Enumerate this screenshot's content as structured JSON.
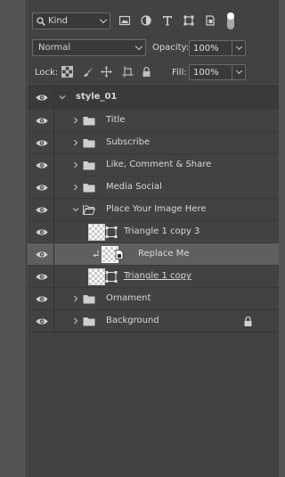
{
  "filter": {
    "kind_label": "Kind",
    "icons": [
      "image-filter-icon",
      "adjustment-filter-icon",
      "type-filter-icon",
      "shape-filter-icon",
      "smart-object-filter-icon"
    ]
  },
  "blend": {
    "mode": "Normal",
    "opacity_label": "Opacity:",
    "opacity_value": "100%"
  },
  "lock": {
    "label": "Lock:",
    "fill_label": "Fill:",
    "fill_value": "100%"
  },
  "layers": {
    "root": {
      "name": "style_01",
      "expanded": true
    },
    "items": [
      {
        "name": "Title",
        "type": "group",
        "expanded": false
      },
      {
        "name": "Subscribe",
        "type": "group",
        "expanded": false
      },
      {
        "name": "Like, Comment & Share",
        "type": "group",
        "expanded": false
      },
      {
        "name": "Media Social",
        "type": "group",
        "expanded": false
      },
      {
        "name": "Place Your Image Here",
        "type": "group",
        "expanded": true
      },
      {
        "name": "Triangle 1 copy 3",
        "type": "shape"
      },
      {
        "name": "Replace Me",
        "type": "smart-object",
        "clipped": true,
        "selected": true
      },
      {
        "name": "Triangle 1 copy",
        "type": "shape"
      },
      {
        "name": "Ornament",
        "type": "group",
        "expanded": false
      },
      {
        "name": "Background",
        "type": "group",
        "expanded": false,
        "locked": true
      }
    ]
  },
  "colors": {
    "panel_bg": "#424242",
    "selected_row": "#5f5f5f",
    "text": "#d8d8d8"
  }
}
